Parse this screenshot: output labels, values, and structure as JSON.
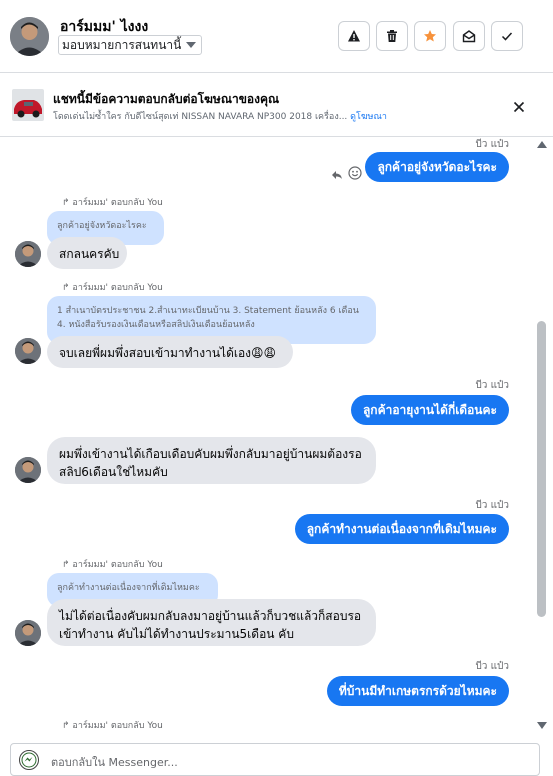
{
  "header": {
    "contact_name": "อาร์มมม' ไงงง",
    "assign_label": "มอบหมายการสนทนานี้"
  },
  "banner": {
    "title": "แชทนี้มีข้อความตอบกลับต่อโฆษณาของคุณ",
    "description": "โดดเด่นไม่ซ้ำใคร กับดีไซน์สุดเท่ NISSAN NAVARA NP300 2018 เครื่อง...",
    "link": "ดูโฆษณา"
  },
  "messages": {
    "m1": {
      "sender": "บีว แป๋ว",
      "text": "ลูกค้าอยู่จังหวัดอะไรคะ"
    },
    "m2": {
      "reply_label": "อาร์มมม' ตอบกลับ You",
      "quote": "ลูกค้าอยู่จังหวัดอะไรคะ",
      "text": "สกลนครคับ"
    },
    "m3": {
      "reply_label": "อาร์มมม' ตอบกลับ You",
      "quote": "1 สำเนาบัตรประชาชน 2.สำเนาทะเบียนบ้าน 3. Statement ย้อนหลัง 6 เดือน 4. หนังสือรับรองเงินเดือนหรือสลิปเงินเดือนย้อนหลัง",
      "text": "จบเลยพี่ผมพึ่งสอบเข้ามาทำงานได้เอง😩😩"
    },
    "m4": {
      "sender": "บีว แป๋ว",
      "text": "ลูกค้าอายุงานได้กี่เดือนคะ"
    },
    "m5": {
      "text": "ผมพึ่งเข้างานได้เกือบเดือบคับผมพึ่งกลับมาอยู่บ้านผมต้องรอสลิป6เดือนใช่ไหมคับ"
    },
    "m6": {
      "sender": "บีว แป๋ว",
      "text": "ลูกค้าทำงานต่อเนื่องจากที่เดิมไหมคะ"
    },
    "m7": {
      "reply_label": "อาร์มมม' ตอบกลับ You",
      "quote": "ลูกค้าทำงานต่อเนื่องจากที่เดิมไหมคะ",
      "text": "ไม่ได้ต่อเนื่องคับผมกลับลงมาอยู่บ้านแล้วก็บวชแล้วก็สอบรอเข้าทำงาน คับไม่ได้ทำงานประมาน5เดือน คับ"
    },
    "m8": {
      "sender": "บีว แป๋ว",
      "text": "ที่บ้านมีทำเกษตรกรด้วยไหมคะ"
    },
    "m9": {
      "reply_label": "อาร์มมม' ตอบกลับ You"
    }
  },
  "composer": {
    "placeholder": "ตอบกลับใน Messenger..."
  },
  "colors": {
    "outgoing_bubble": "#1877f2",
    "incoming_bubble": "#e4e6eb",
    "quoted_bubble": "#cfe2ff",
    "star": "#f7923b"
  },
  "icons": [
    "warning-icon",
    "trash-icon",
    "star-icon",
    "mark-unread-icon",
    "check-icon",
    "close-icon",
    "reply-icon",
    "emoji-icon",
    "messenger-icon"
  ]
}
